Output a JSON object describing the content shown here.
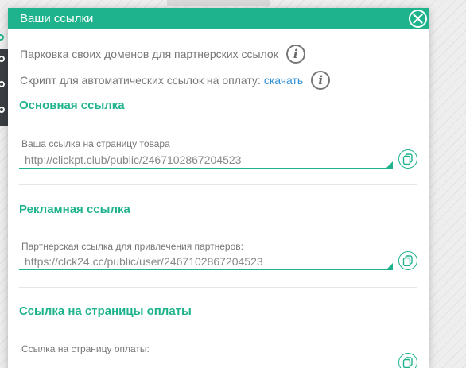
{
  "modal": {
    "title": "Ваши ссылки"
  },
  "info": {
    "parking_text": "Парковка своих доменов для партнерских ссылок",
    "script_text": "Скрипт для автоматических ссылок на оплату:",
    "script_link": "скачать"
  },
  "sections": [
    {
      "title": "Основная ссылка",
      "field_label": "Ваша ссылка на страницу товара",
      "field_value": "http://clickpt.club/public/2467102867204523"
    },
    {
      "title": "Рекламная ссылка",
      "field_label": "Партнерская ссылка для привлечения партнеров:",
      "field_value": "https://clck24.cc/public/user/2467102867204523"
    },
    {
      "title": "Ссылка на страницы оплаты",
      "field_label": "Ссылка на страницу оплаты:",
      "field_value": ""
    }
  ],
  "colors": {
    "accent": "#1fb38d",
    "link": "#2e8fd6",
    "text_muted": "#777777"
  },
  "icons": [
    "close-icon",
    "info-icon",
    "copy-icon"
  ]
}
